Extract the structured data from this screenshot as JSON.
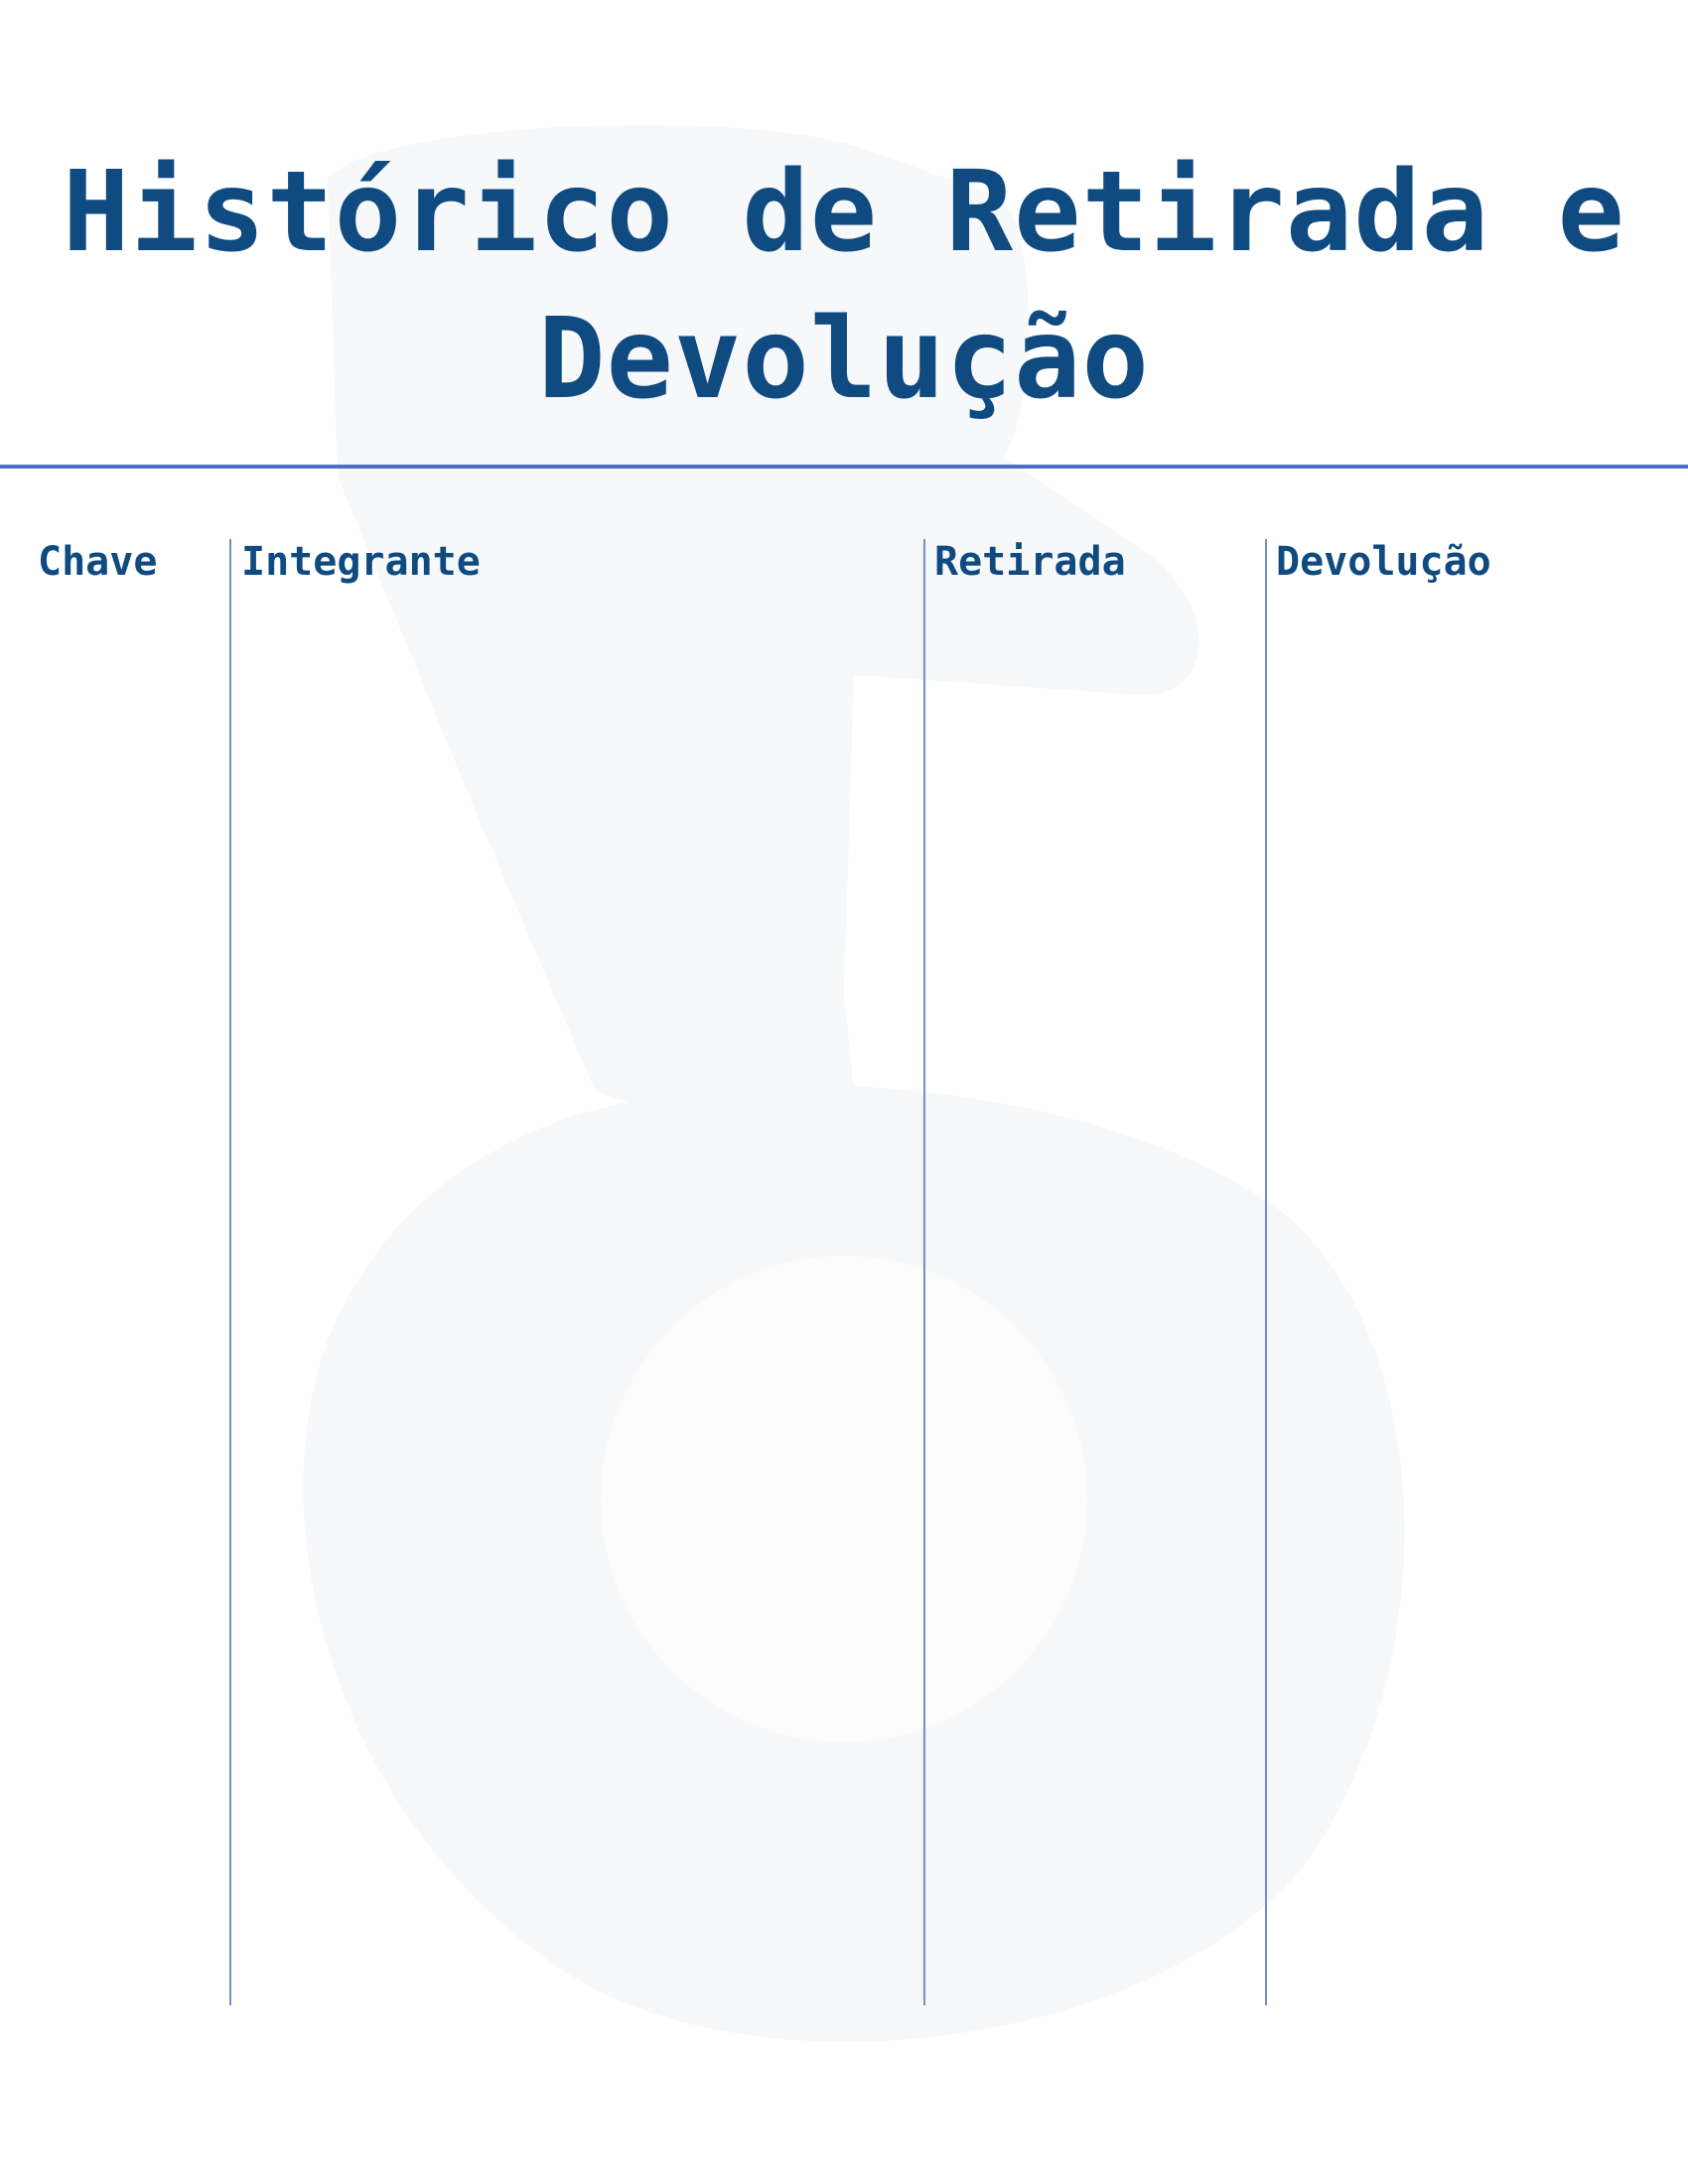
{
  "document": {
    "title": "Histórico de Retirada e Devolução",
    "columns": [
      {
        "label": "Chave"
      },
      {
        "label": "Integrante"
      },
      {
        "label": "Retirada"
      },
      {
        "label": "Devolução"
      }
    ]
  },
  "colors": {
    "heading": "#0f4a80",
    "rule": "#4a6fc6",
    "column_divider": "#6d8fd4",
    "watermark": "#f7f8fa"
  }
}
